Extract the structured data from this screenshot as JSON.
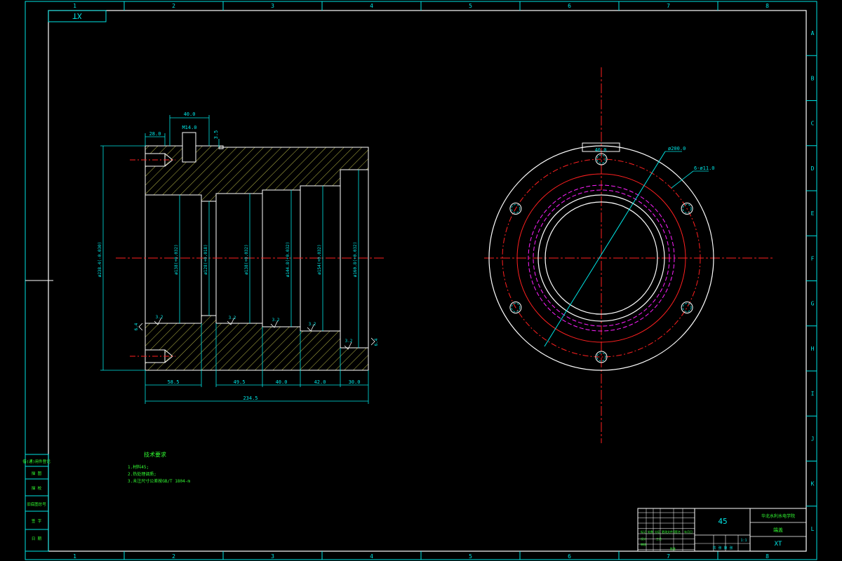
{
  "sheet": {
    "zone_columns": [
      "1",
      "2",
      "3",
      "4",
      "5",
      "6",
      "7",
      "8"
    ],
    "zone_rows": [
      "A",
      "B",
      "C",
      "D",
      "E",
      "F",
      "G",
      "H",
      "I",
      "J",
      "K",
      "L"
    ],
    "drawing_code": "XT"
  },
  "section_view": {
    "dimensions": {
      "top_slot_width": "40.0",
      "slot": "M14.0",
      "left_chamfer": "28.0",
      "right_step": "3.5",
      "seg1": "58.5",
      "seg2": "49.5",
      "seg3": "40.0",
      "seg4": "42.0",
      "seg5": "30.0",
      "overall_length": "234.5",
      "outer_dia": "ø238.4(-0.030)",
      "bore1": "ø138(+0.032)",
      "bore2": "ø128(+0.018)",
      "bore3": "ø138(+0.032)",
      "bore4": "ø144.8(+0.032)",
      "bore5": "ø154(+0.032)",
      "bore6": "ø160.8(+0.032)",
      "finish_1": "3.2",
      "finish_2": "3.2",
      "finish_3": "3.2",
      "finish_4": "3.2",
      "finish_5": "3.2",
      "left_finish": "6.4",
      "right_finish": "6.4"
    }
  },
  "end_view": {
    "key_width": "40.0",
    "pcd": "ø200.0",
    "holes": "6-ø11.0"
  },
  "notes": {
    "heading": "技术要求",
    "lines": [
      "1.材料45;",
      "2.热处理调质;",
      "3.未注尺寸公差按GB/T 1804-m"
    ]
  },
  "left_strip": [
    "借(通)用件登记",
    "描 图",
    "描 校",
    "旧底图总号",
    "签 字",
    "日 期"
  ],
  "title_block": {
    "material": "45",
    "school": "华北水利水电学院",
    "part_name": "端盖",
    "code": "XT",
    "scale": "1:1",
    "sheet_label": "共 张 第 张",
    "row_labels": [
      "标记",
      "处数",
      "分区",
      "更改文件号",
      "签名",
      "年月日"
    ],
    "sign_labels": [
      "设计",
      "审核",
      "工艺",
      "批准"
    ]
  },
  "colors": {
    "frame": "#00e5e5",
    "outline": "#ffffff",
    "center": "#ff2020",
    "dim": "#00e5e5",
    "hatch": "#e6e65a",
    "magenta": "#ff20ff",
    "text_green": "#33ff33",
    "bg": "#000000"
  }
}
